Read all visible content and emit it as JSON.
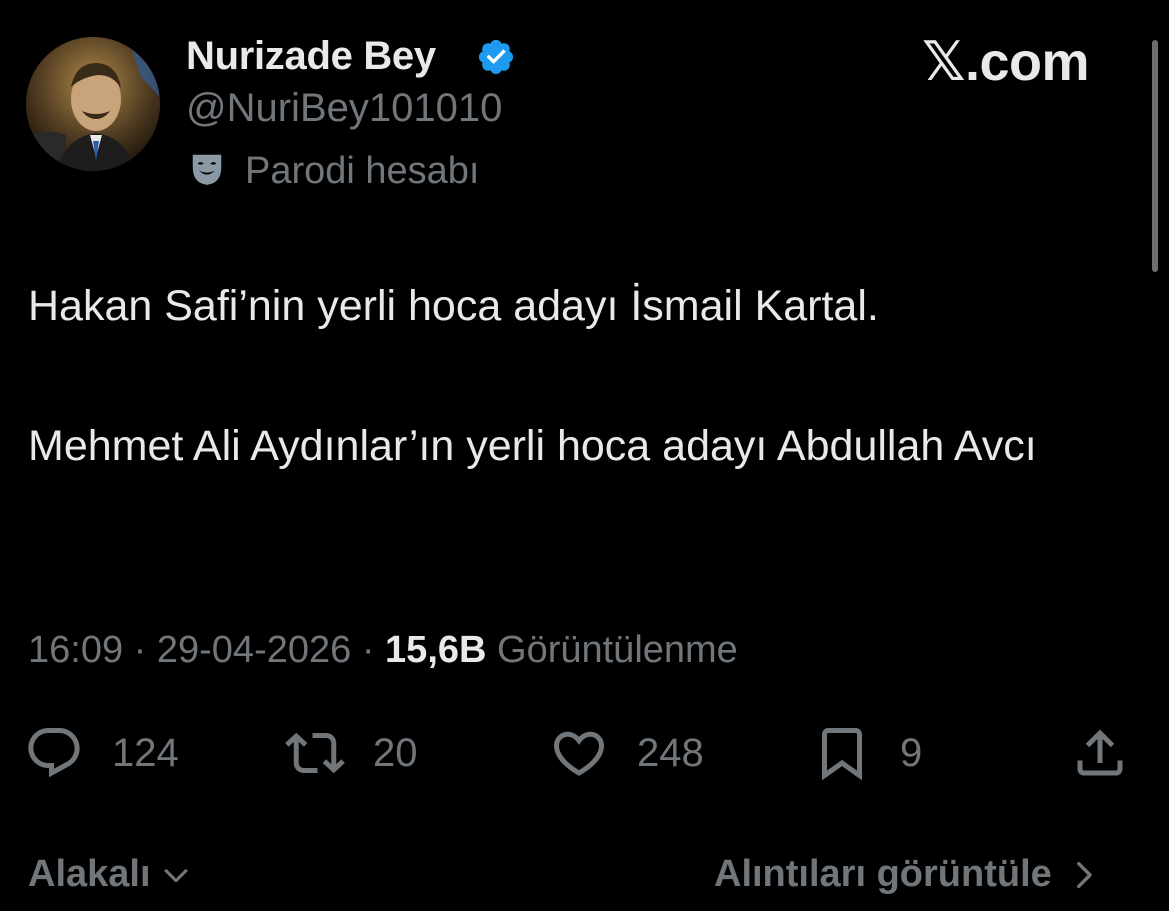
{
  "author": {
    "display_name": "Nurizade Bey",
    "handle": "@NuriBey101010",
    "label": "Parodi hesabı",
    "verified_icon": "verified-badge-icon",
    "label_icon": "parody-mask-icon"
  },
  "brand": {
    "text": "𝕏.com",
    "verified_color": "#1d9bf0"
  },
  "tweet": {
    "paragraph_1": "Hakan Safi’nin yerli hoca adayı İsmail Kartal.",
    "paragraph_2": "Mehmet Ali Aydınlar’ın yerli hoca adayı Abdullah Avcı"
  },
  "meta": {
    "time": "16:09",
    "sep_1": " · ",
    "date": "29-04-2026",
    "sep_2": " · ",
    "views_count": "15,6B",
    "views_label": " Görüntülenme"
  },
  "actions": {
    "replies": "124",
    "retweets": "20",
    "likes": "248",
    "bookmarks": "9"
  },
  "footer": {
    "sort_label": "Alakalı",
    "quotes_label": "Alıntıları görüntüle"
  },
  "colors": {
    "background": "#000000",
    "primary_text": "#e7e9ea",
    "secondary_text": "#71767b"
  }
}
